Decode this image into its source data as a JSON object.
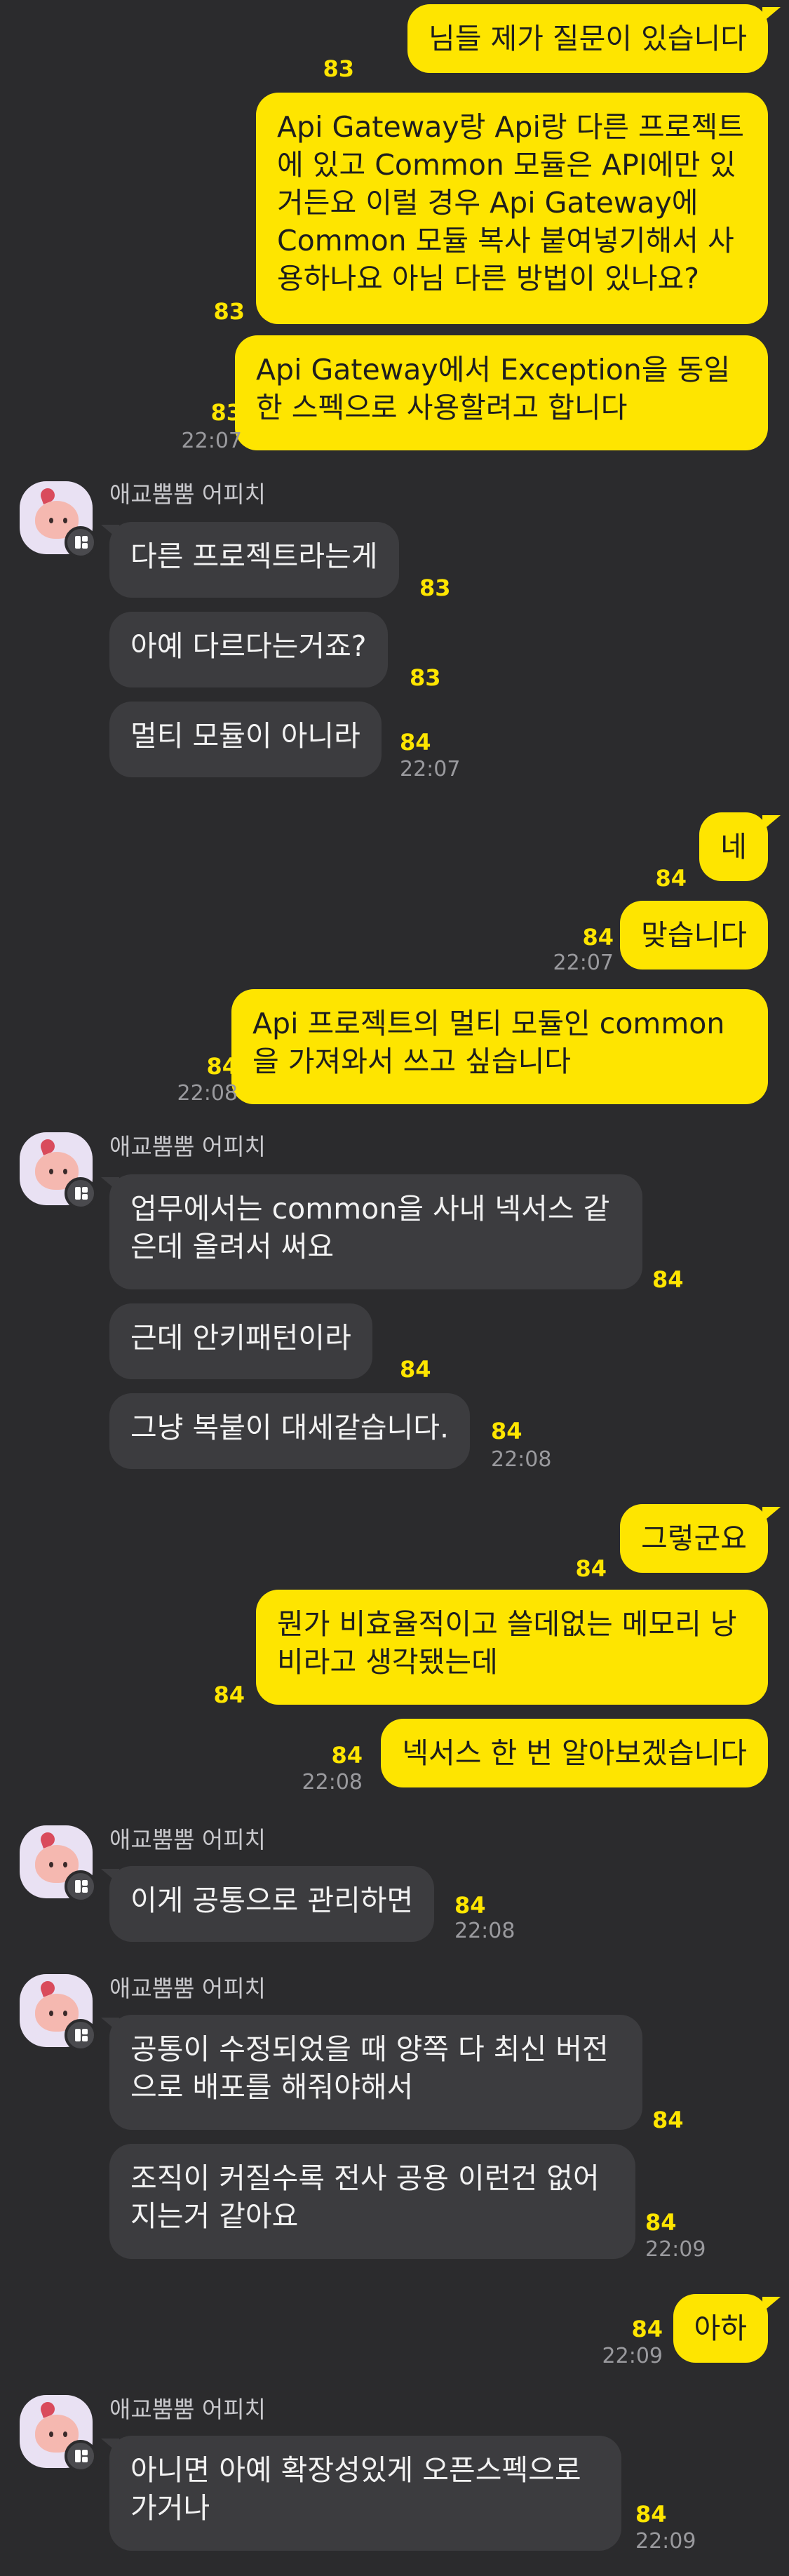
{
  "chat": {
    "sender_name": "애교뿜뿜 어피치",
    "messages": [
      {
        "from": "me",
        "text": "님들 제가 질문이 있습니다",
        "unread": "83",
        "time": ""
      },
      {
        "from": "me",
        "text": "Api Gateway랑 Api랑 다른 프로젝트\n에 있고 Common 모듈은 API에만 있\n거든요 이럴 경우 Api Gateway에\nCommon 모듈 복사 붙여넣기해서 사\n용하나요 아님 다른 방법이 있나요?",
        "unread": "83",
        "time": ""
      },
      {
        "from": "me",
        "text": "Api Gateway에서 Exception을 동일\n한 스펙으로 사용할려고 합니다",
        "unread": "83",
        "time": "22:07"
      },
      {
        "from": "them",
        "text": "다른 프로젝트라는게",
        "unread": "83",
        "time": ""
      },
      {
        "from": "them",
        "text": "아예 다르다는거죠?",
        "unread": "83",
        "time": ""
      },
      {
        "from": "them",
        "text": "멀티 모듈이 아니라",
        "unread": "84",
        "time": "22:07"
      },
      {
        "from": "me",
        "text": "네",
        "unread": "84",
        "time": ""
      },
      {
        "from": "me",
        "text": "맞습니다",
        "unread": "84",
        "time": "22:07"
      },
      {
        "from": "me",
        "text": "Api 프로젝트의 멀티 모듈인 common\n을 가져와서 쓰고 싶습니다",
        "unread": "84",
        "time": "22:08"
      },
      {
        "from": "them",
        "text": "업무에서는 common을 사내 넥서스 같\n은데 올려서 써요",
        "unread": "84",
        "time": ""
      },
      {
        "from": "them",
        "text": "근데 안키패턴이라",
        "unread": "84",
        "time": ""
      },
      {
        "from": "them",
        "text": "그냥 복붙이 대세같습니다.",
        "unread": "84",
        "time": "22:08"
      },
      {
        "from": "me",
        "text": "그렇군요",
        "unread": "84",
        "time": ""
      },
      {
        "from": "me",
        "text": "뭔가 비효율적이고 쓸데없는 메모리 낭\n비라고 생각됐는데",
        "unread": "84",
        "time": ""
      },
      {
        "from": "me",
        "text": "넥서스 한 번 알아보겠습니다",
        "unread": "84",
        "time": "22:08"
      },
      {
        "from": "them",
        "text": "이게 공통으로 관리하면",
        "unread": "84",
        "time": "22:08"
      },
      {
        "from": "them",
        "text": "공통이 수정되었을 때 양쪽 다 최신 버전\n으로 배포를 해줘야해서",
        "unread": "84",
        "time": ""
      },
      {
        "from": "them",
        "text": "조직이 커질수록 전사 공용 이런건 없어\n지는거 같아요",
        "unread": "84",
        "time": "22:09"
      },
      {
        "from": "me",
        "text": "아하",
        "unread": "84",
        "time": "22:09"
      },
      {
        "from": "them",
        "text": "아니면 아예 확장성있게 오픈스펙으로\n가거나",
        "unread": "84",
        "time": "22:09"
      }
    ]
  }
}
